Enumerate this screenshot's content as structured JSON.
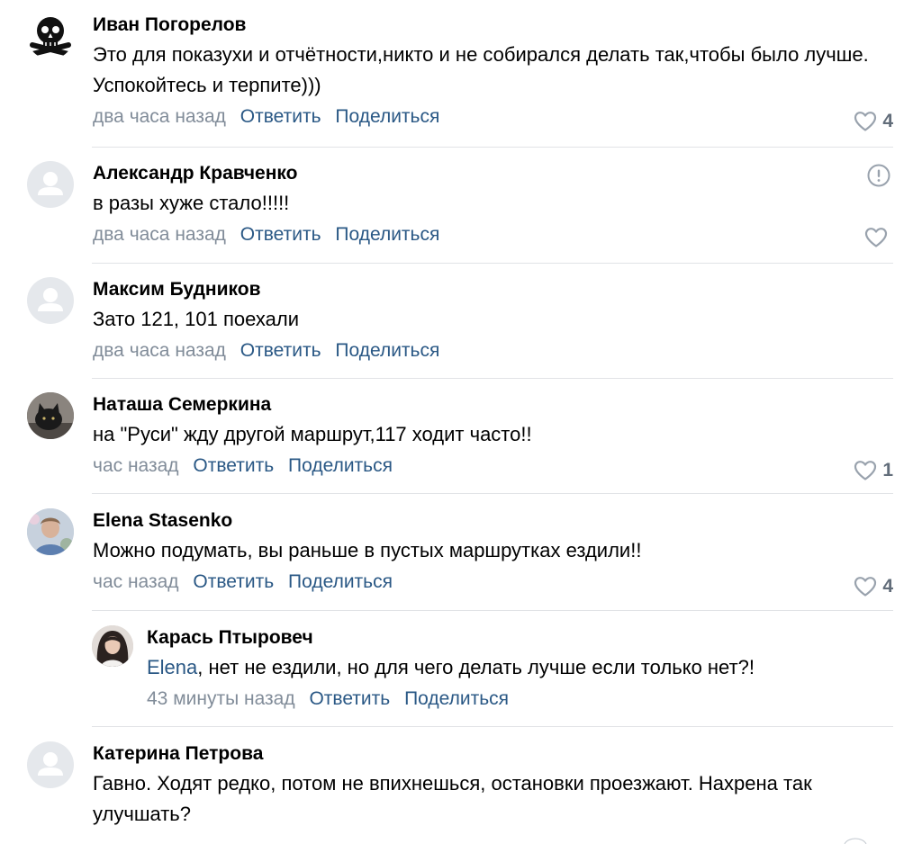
{
  "comments": [
    {
      "author": "Иван Погорелов",
      "text": "Это для показухи и отчётности,никто и не собирался делать так,чтобы было лучше. Успокойтесь и терпите)))",
      "time": "два часа назад",
      "reply": "Ответить",
      "share": "Поделиться",
      "likes": "4",
      "avatar": "pirate-skull"
    },
    {
      "author": "Александр Кравченко",
      "text": "в разы хуже стало!!!!!",
      "time": "два часа назад",
      "reply": "Ответить",
      "share": "Поделиться",
      "likes": "",
      "avatar": "default-user"
    },
    {
      "author": "Максим Будников",
      "text": "Зато 121, 101 поехали",
      "time": "два часа назад",
      "reply": "Ответить",
      "share": "Поделиться",
      "likes": "",
      "avatar": "default-user"
    },
    {
      "author": "Наташа Семеркина",
      "text": "на \"Руси\" жду другой маршрут,117 ходит часто!!",
      "time": "час назад",
      "reply": "Ответить",
      "share": "Поделиться",
      "likes": "1",
      "avatar": "black-cat-photo"
    },
    {
      "author": "Elena Stasenko",
      "text": "Можно подумать, вы раньше в пустых маршрутках ездили!!",
      "time": "час назад",
      "reply": "Ответить",
      "share": "Поделиться",
      "likes": "4",
      "avatar": "woman-photo"
    },
    {
      "author": "Карась Птыровеч",
      "mention": "Elena",
      "text": ", нет не ездили, но для чего делать лучше если только нет?!",
      "time": "43 минуты назад",
      "reply": "Ответить",
      "share": "Поделиться",
      "likes": "",
      "avatar": "girl-photo"
    },
    {
      "author": "Катерина Петрова",
      "text": "Гавно. Ходят редко, потом не впихнешься, остановки проезжают. Нахрена так улучшать?",
      "avatar": "default-user"
    }
  ],
  "colors": {
    "link": "#2a5885",
    "meta": "#818c99",
    "separator": "#e1e3e6",
    "icon": "#99a2ad"
  }
}
